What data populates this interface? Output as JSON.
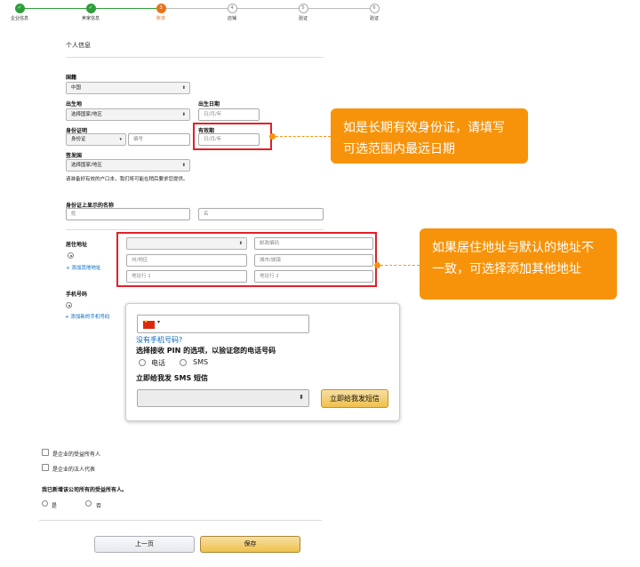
{
  "progress": {
    "steps": [
      {
        "label": "企业信息",
        "num": "✓",
        "state": "done"
      },
      {
        "label": "卖家信息",
        "num": "✓",
        "state": "done"
      },
      {
        "label": "账单",
        "num": "3",
        "state": "current"
      },
      {
        "label": "店铺",
        "num": "4",
        "state": "todo"
      },
      {
        "label": "验证",
        "num": "5",
        "state": "todo"
      },
      {
        "label": "验证",
        "num": "6",
        "state": "todo"
      }
    ]
  },
  "section_title": "个人信息",
  "nationality": {
    "label": "国籍",
    "value": "中国"
  },
  "birthplace": {
    "label": "出生地",
    "value": "选择国家/地区"
  },
  "birthdate": {
    "label": "出生日期",
    "placeholder": "日/月/年"
  },
  "id_doc": {
    "label": "身份证明",
    "type_value": "身份证",
    "number_placeholder": "编号"
  },
  "expiry": {
    "label": "有效期",
    "placeholder": "日/月/年"
  },
  "issuing_country": {
    "label": "签发国",
    "value": "选择国家/地区"
  },
  "note": "请准备好有效的户口本，我们将可能在稍后要求您提供。",
  "name_on_id": {
    "label": "身份证上显示的名称",
    "last_placeholder": "姓",
    "first_placeholder": "名"
  },
  "address": {
    "label": "居住地址",
    "country_placeholder": "",
    "postal_placeholder": "邮政编码",
    "province_placeholder": "州/地区",
    "city_placeholder": "城市/城镇",
    "line1_placeholder": "地址行 1",
    "line2_placeholder": "地址行 2",
    "add_link": "+ 添加其他地址"
  },
  "phone": {
    "label": "手机号码",
    "add_link": "+ 添加新的手机号码",
    "popup": {
      "no_phone_link": "没有手机号码?",
      "pin_title": "选择接收 PIN 的选项，以验证您的电话号码",
      "option_call": "电话",
      "option_sms": "SMS",
      "sms_title": "立即给我发 SMS 短信",
      "send_button": "立即给我发短信"
    }
  },
  "callouts": {
    "expiry_tip": "如是长期有效身份证，请填写可选范围内最远日期",
    "address_tip": "如果居住地址与默认的地址不一致，可选择添加其他地址"
  },
  "owner_checkbox": "是企业的受益所有人",
  "legal_rep_checkbox": "是企业的法人代表",
  "beneficial_question": "我已新增该公司所有的受益所有人。",
  "answer_yes": "是",
  "answer_no": "否",
  "buttons": {
    "prev": "上一页",
    "save": "保存"
  },
  "colors": {
    "callout": "#f7930a",
    "highlight": "#e32028",
    "done": "#2e9e3a",
    "current": "#e8731a"
  }
}
